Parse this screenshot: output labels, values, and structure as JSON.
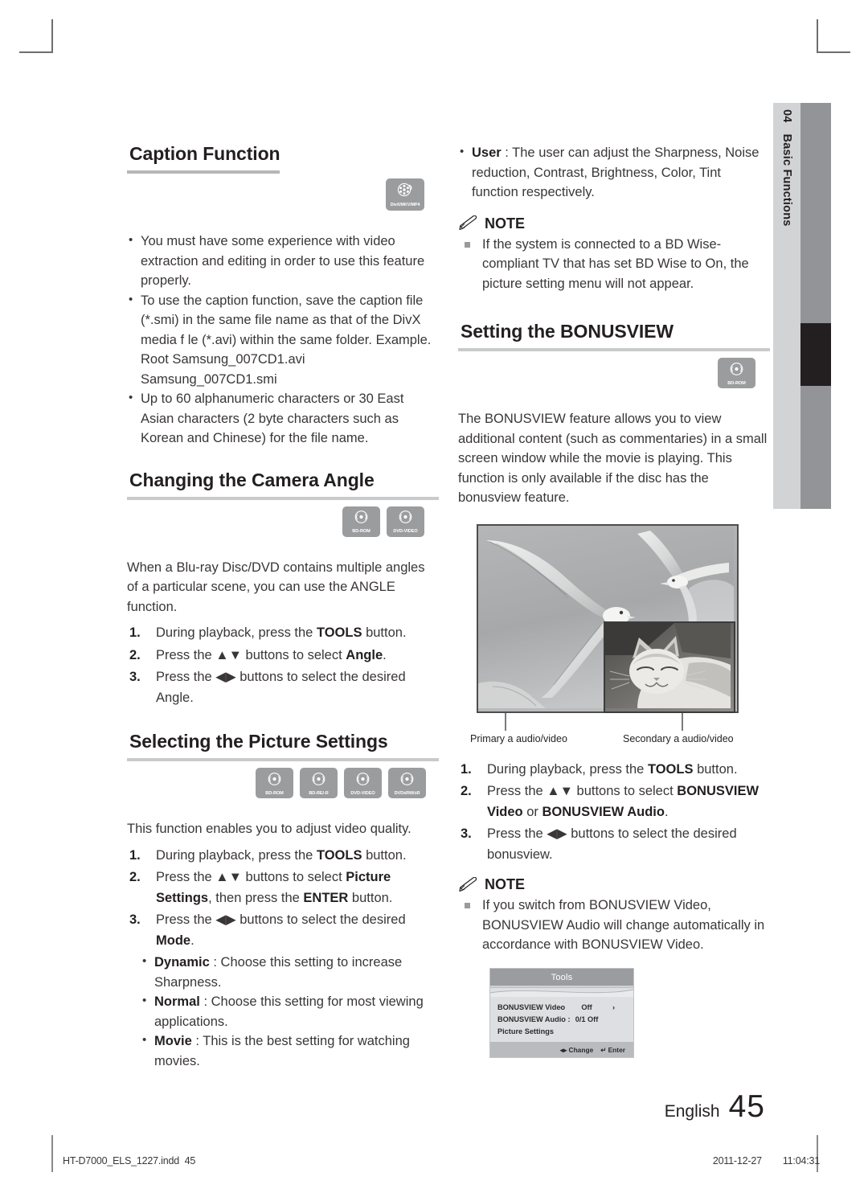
{
  "side_tab": {
    "chapter_number": "04",
    "chapter_title": "Basic Functions"
  },
  "left_column": {
    "caption_function": {
      "heading": "Caption Function",
      "disc_icons": [
        {
          "label": "DivX/MKV/MP4",
          "name": "divx-mkv-mp4-icon"
        }
      ],
      "bullets": [
        "You must have some experience with video extraction and editing in order to use this feature properly.",
        "To use the caption function, save the caption file (*.smi) in the same file name as that of the DivX media f le (*.avi) within the same folder.",
        "Up to 60 alphanumeric characters or 30 East Asian characters (2 byte characters such as Korean and Chinese) for the file name."
      ],
      "example_line_1": "Example. Root Samsung_007CD1.avi",
      "example_line_2": "Samsung_007CD1.smi"
    },
    "camera_angle": {
      "heading": "Changing the Camera Angle",
      "disc_icons": [
        {
          "label": "BD-ROM",
          "name": "bd-rom-icon"
        },
        {
          "label": "DVD-VIDEO",
          "name": "dvd-video-icon"
        }
      ],
      "intro": "When a Blu-ray Disc/DVD contains multiple angles of a particular scene, you can use the ANGLE function.",
      "steps": [
        {
          "num": "1.",
          "pre": "During playback, press the ",
          "bold": "TOOLS",
          "post": " button."
        },
        {
          "num": "2.",
          "pre": "Press the ▲▼ buttons to select ",
          "bold": "Angle",
          "post": "."
        },
        {
          "num": "3.",
          "pre": "Press the ◀▶ buttons to select the desired ",
          "bold": "",
          "post": "Angle."
        }
      ]
    },
    "picture_settings": {
      "heading": "Selecting the Picture Settings",
      "disc_icons": [
        {
          "label": "BD-ROM",
          "name": "bd-rom-icon"
        },
        {
          "label": "BD-RE/-R",
          "name": "bd-re-r-icon"
        },
        {
          "label": "DVD-VIDEO",
          "name": "dvd-video-icon"
        },
        {
          "label": "DVD±RW/±R",
          "name": "dvd-rw-r-icon"
        }
      ],
      "intro": "This function enables you to adjust video quality.",
      "steps": [
        {
          "num": "1.",
          "pre": "During playback, press the ",
          "bold": "TOOLS",
          "post": " button."
        },
        {
          "num": "2.",
          "pre": "Press the ▲▼ buttons to select ",
          "bold": "Picture Settings",
          "post": ", then press the ",
          "bold2": "ENTER",
          "post2": " button."
        },
        {
          "num": "3.",
          "pre": "Press the ◀▶ buttons to select the desired ",
          "bold": "Mode",
          "post": "."
        }
      ],
      "modes": [
        {
          "name": "Dynamic",
          "sep": " : ",
          "text": "Choose this setting to increase Sharpness."
        },
        {
          "name": "Normal",
          "sep": " : ",
          "text": "Choose this setting for most viewing applications."
        },
        {
          "name": "Movie",
          "sep": " : ",
          "text": "This is the best setting for watching movies."
        }
      ]
    }
  },
  "right_column": {
    "user_mode": {
      "name": "User",
      "sep": " : ",
      "text": "The user can adjust the Sharpness, Noise reduction, Contrast, Brightness, Color, Tint function respectively."
    },
    "note_1": {
      "heading": "NOTE",
      "items": [
        "If the system is connected to a BD Wise-compliant TV that has set BD Wise to On, the picture setting menu will not appear."
      ]
    },
    "bonusview": {
      "heading": "Setting the BONUSVIEW",
      "disc_icons": [
        {
          "label": "BD-ROM",
          "name": "bd-rom-icon"
        }
      ],
      "intro": "The BONUSVIEW feature allows you to view additional content (such as commentaries) in a small screen window while the movie is playing. This function is only available if the disc has the bonusview feature.",
      "photo_caption_primary": "Primary a audio/video",
      "photo_caption_secondary": "Secondary a audio/video",
      "steps": [
        {
          "num": "1.",
          "pre": "During playback, press the ",
          "bold": "TOOLS",
          "post": " button."
        },
        {
          "num": "2.",
          "pre": "Press the ▲▼ buttons to select ",
          "bold": "BONUSVIEW Video",
          "mid": " or ",
          "bold2": "BONUSVIEW Audio",
          "post": "."
        },
        {
          "num": "3.",
          "pre": "Press the ◀▶ buttons to select the desired bonusview.",
          "bold": "",
          "post": ""
        }
      ]
    },
    "note_2": {
      "heading": "NOTE",
      "items": [
        "If you switch from BONUSVIEW Video, BONUSVIEW Audio will change automatically in accordance with BONUSVIEW Video."
      ]
    }
  },
  "osd": {
    "title": "Tools",
    "rows": [
      {
        "name": "BONUSVIEW Video",
        "arrow_left": "‹",
        "value": "Off",
        "arrow_right": "›"
      },
      {
        "name": "BONUSVIEW Audio :",
        "arrow_left": "",
        "value": "0/1 Off",
        "arrow_right": ""
      },
      {
        "name": "Picture Settings",
        "arrow_left": "",
        "value": "",
        "arrow_right": ""
      }
    ],
    "footer_change": "◂▸ Change",
    "footer_enter": "↵ Enter"
  },
  "page_footer": {
    "language": "English",
    "page_number": "45",
    "file_name": "HT-D7000_ELS_1227.indd",
    "file_page": "45",
    "date": "2011-12-27",
    "time": "11:04:31"
  }
}
